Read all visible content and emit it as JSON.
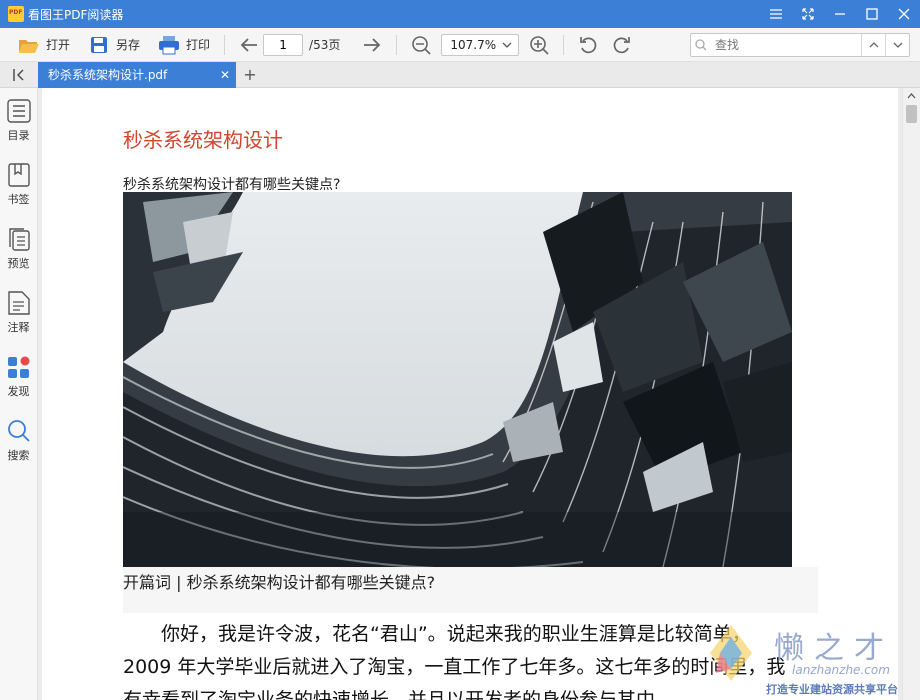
{
  "window": {
    "title": "看图王PDF阅读器",
    "controls": [
      "menu-icon",
      "fullscreen-icon",
      "minimize-icon",
      "maximize-icon",
      "close-icon"
    ]
  },
  "toolbar": {
    "open_label": "打开",
    "saveas_label": "另存",
    "print_label": "打印",
    "page_current": "1",
    "page_total": "/53页",
    "zoom_value": "107.7%",
    "search_placeholder": "查找"
  },
  "tabs": [
    {
      "label": "秒杀系统架构设计.pdf",
      "active": true
    }
  ],
  "sidebar": {
    "items": [
      {
        "label": "目录",
        "icon": "list-icon"
      },
      {
        "label": "书签",
        "icon": "bookmark-icon"
      },
      {
        "label": "预览",
        "icon": "pages-icon"
      },
      {
        "label": "注释",
        "icon": "note-icon"
      },
      {
        "label": "发现",
        "icon": "apps-icon"
      },
      {
        "label": "搜索",
        "icon": "search-icon"
      }
    ]
  },
  "document": {
    "title": "秒杀系统架构设计",
    "subtitle": "秒杀系统架构设计都有哪些关键点?",
    "quote": "开篇词 | 秒杀系统架构设计都有哪些关键点?",
    "paragraph_lines": [
      "　　你好，我是许令波，花名“君山”。说起来我的职业生涯算是比较简单，",
      "2009 年大学毕业后就进入了淘宝，一直工作了七年多。这七年多的时间里，我",
      "有幸看到了淘宝业务的快速增长，并且以开发者的身份参与其中。"
    ]
  },
  "watermark": {
    "brand": "懒之才",
    "domain": "lanzhanzhe.com",
    "tagline": "打造专业建站资源共享平台"
  },
  "colors": {
    "accent": "#3c7fd7",
    "title_red": "#d2452d"
  }
}
